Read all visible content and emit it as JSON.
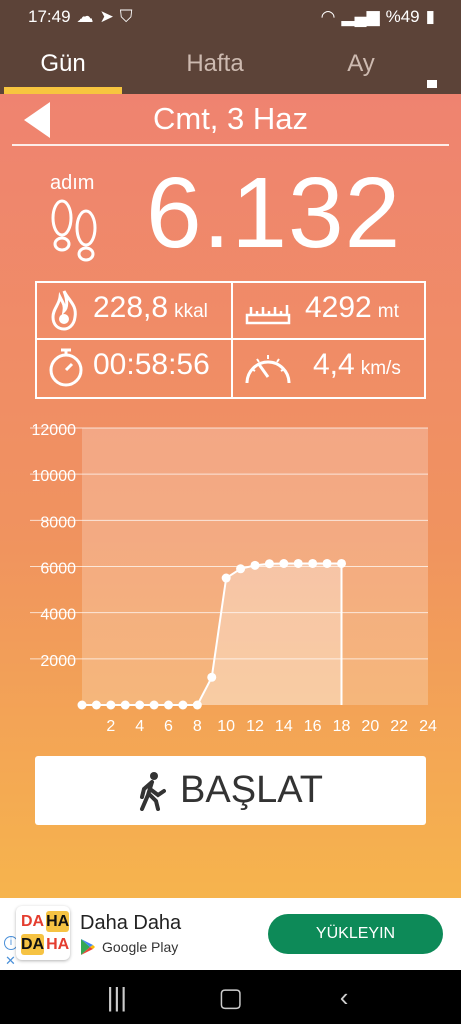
{
  "statusbar": {
    "time": "17:49",
    "battery": "%49"
  },
  "tabs": [
    {
      "label": "Gün"
    },
    {
      "label": "Hafta"
    },
    {
      "label": "Ay"
    }
  ],
  "date": "Cmt, 3 Haz",
  "steps": {
    "label": "adım",
    "value": "6.132"
  },
  "stats": {
    "calories": {
      "value": "228,8",
      "unit": "kkal"
    },
    "distance": {
      "value": "4292",
      "unit": "mt"
    },
    "duration": {
      "value": "00:58:56"
    },
    "speed": {
      "value": "4,4",
      "unit": "km/s"
    }
  },
  "chart_data": {
    "type": "area",
    "x": [
      0,
      1,
      2,
      3,
      4,
      5,
      6,
      7,
      8,
      9,
      10,
      11,
      12,
      13,
      14,
      15,
      16,
      17,
      18
    ],
    "y": [
      0,
      0,
      0,
      0,
      0,
      0,
      0,
      0,
      0,
      1200,
      5500,
      5900,
      6050,
      6120,
      6130,
      6132,
      6132,
      6132,
      6132
    ],
    "yticks": [
      "12000",
      "10000",
      "8000",
      "6000",
      "4000",
      "2000"
    ],
    "xticks": [
      "2",
      "4",
      "6",
      "8",
      "10",
      "12",
      "14",
      "16",
      "18",
      "20",
      "22",
      "24"
    ],
    "ylim": [
      0,
      12000
    ],
    "xlim": [
      0,
      24
    ],
    "grid": true
  },
  "start_button": {
    "label": "BAŞLAT"
  },
  "ad": {
    "title": "Daha Daha",
    "store": "Google Play",
    "cta": "YÜKLEYIN",
    "logo": [
      "DA",
      "HA",
      "DA",
      "HA"
    ]
  },
  "colors": {
    "header": "#5c4338",
    "accent": "#f7c53f",
    "cta": "#0d8a58"
  }
}
